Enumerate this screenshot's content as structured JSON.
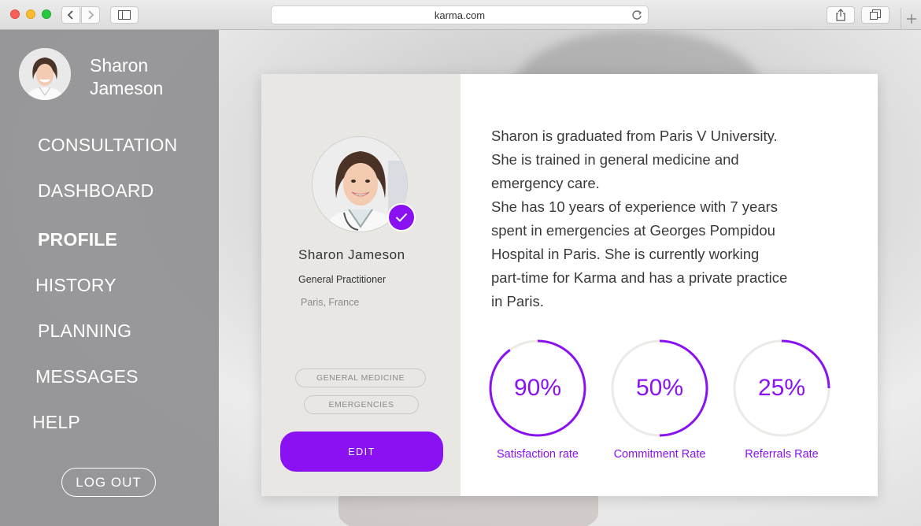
{
  "browser": {
    "url": "karma.com"
  },
  "user": {
    "name": "Sharon Jameson"
  },
  "nav": [
    {
      "label": "CONSULTATION",
      "active": false
    },
    {
      "label": "DASHBOARD",
      "active": false
    },
    {
      "label": "PROFILE",
      "active": true
    },
    {
      "label": "HISTORY",
      "active": false
    },
    {
      "label": "PLANNING",
      "active": false
    },
    {
      "label": "MESSAGES",
      "active": false
    },
    {
      "label": "HELP",
      "active": false
    }
  ],
  "logout_label": "LOG OUT",
  "profile": {
    "name": "Sharon Jameson",
    "role": "General Practitioner",
    "location": "Paris, France",
    "tags": [
      "GENERAL MEDICINE",
      "EMERGENCIES"
    ],
    "edit_label": "EDIT",
    "bio": [
      "Sharon is graduated from Paris V University.",
      "She is trained in general medicine and",
      "emergency care.",
      "She has 10 years of experience with 7 years",
      "spent in emergencies at Georges Pompidou",
      "Hospital in Paris. She is currently working",
      "part-time for Karma and has a private practice",
      "in Paris."
    ]
  },
  "stats": [
    {
      "value": "90%",
      "fraction": 0.9,
      "label": "Satisfaction rate"
    },
    {
      "value": "50%",
      "fraction": 0.5,
      "label": "Commitment Rate"
    },
    {
      "value": "25%",
      "fraction": 0.25,
      "label": "Referrals Rate"
    }
  ],
  "colors": {
    "accent": "#8a12f2",
    "track": "#ebeae6",
    "sidebar": "#8c8c8f"
  }
}
